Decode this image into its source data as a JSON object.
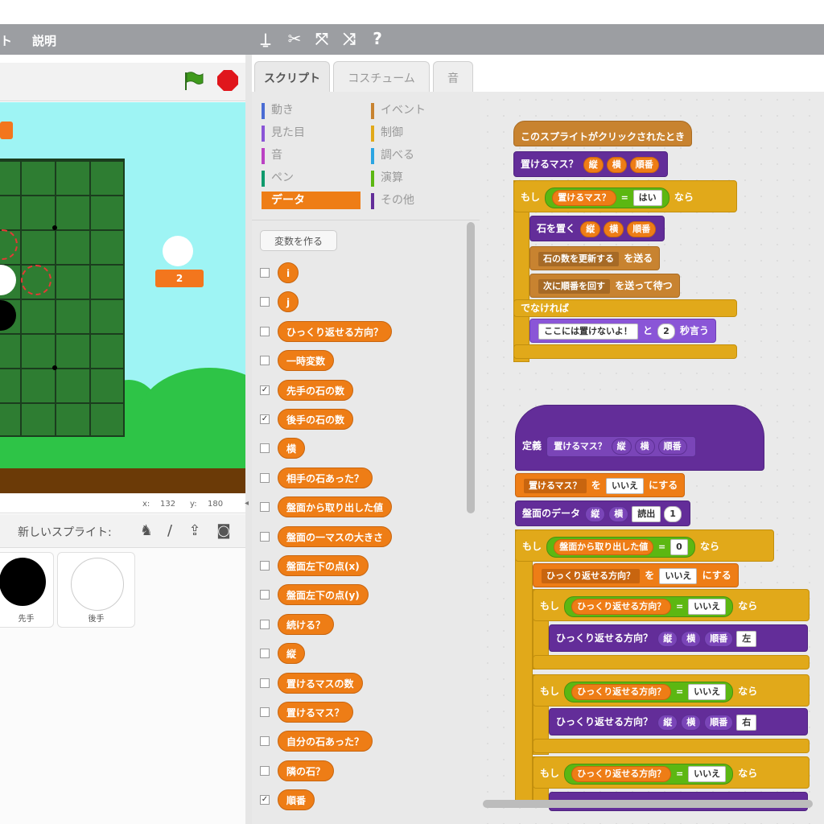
{
  "menu": {
    "item1": "ト",
    "item2": "説明"
  },
  "toolbar_icons": [
    "stamp-icon",
    "cut-icon",
    "grow-icon",
    "shrink-icon",
    "help-icon"
  ],
  "stage": {
    "score_label": "2",
    "coords": {
      "x_label": "x:",
      "x_value": "132",
      "y_label": "y:",
      "y_value": "180"
    }
  },
  "sprites": {
    "new_sprite_label": "新しいスプライト:",
    "items": [
      {
        "name": "先手"
      },
      {
        "name": "後手"
      }
    ]
  },
  "tabs": {
    "script": "スクリプト",
    "costume": "コスチューム",
    "sound": "音"
  },
  "categories": {
    "motion": "動き",
    "looks": "見た目",
    "sound": "音",
    "pen": "ペン",
    "data": "データ",
    "events": "イベント",
    "control": "制御",
    "sensing": "調べる",
    "operators": "演算",
    "more": "その他"
  },
  "palette": {
    "make_variable": "変数を作る",
    "variables": [
      {
        "name": "i",
        "checked": false
      },
      {
        "name": "j",
        "checked": false
      },
      {
        "name": "ひっくり返せる方向？",
        "checked": false
      },
      {
        "name": "一時変数",
        "checked": false
      },
      {
        "name": "先手の石の数",
        "checked": true
      },
      {
        "name": "後手の石の数",
        "checked": true
      },
      {
        "name": "横",
        "checked": false
      },
      {
        "name": "相手の石あった？",
        "checked": false
      },
      {
        "name": "盤面から取り出した値",
        "checked": false
      },
      {
        "name": "盤面の一マスの大きさ",
        "checked": false
      },
      {
        "name": "盤面左下の点(x)",
        "checked": false
      },
      {
        "name": "盤面左下の点(y)",
        "checked": false
      },
      {
        "name": "続ける？",
        "checked": false
      },
      {
        "name": "縦",
        "checked": false
      },
      {
        "name": "置けるマスの数",
        "checked": false
      },
      {
        "name": "置けるマス？",
        "checked": false
      },
      {
        "name": "自分の石あった？",
        "checked": false
      },
      {
        "name": "隣の石？",
        "checked": false
      },
      {
        "name": "順番",
        "checked": true
      }
    ]
  },
  "script1": {
    "hat": "このスプライトがクリックされたとき",
    "call1": "置けるマス？",
    "arg_tate": "縦",
    "arg_yoko": "横",
    "arg_junban": "順番",
    "if_label": "もし",
    "then_label": "なら",
    "cond_var": "置けるマス？",
    "eq": "=",
    "cond_val": "はい",
    "place": "石を置く",
    "bcast1": "石の数を更新する",
    "bcast1_tail": "を送る",
    "bcast2": "次に順番を回す",
    "bcast2_tail": "を送って待つ",
    "else_label": "でなければ",
    "say_text": "ここには置けないよ！",
    "say_mid": "と",
    "say_secs": "2",
    "say_tail": "秒言う"
  },
  "script2": {
    "define_label": "定義",
    "define_name": "置けるマス？",
    "p1": "縦",
    "p2": "横",
    "p3": "順番",
    "set_var": "置けるマス？",
    "set_to": "を",
    "set_val": "いいえ",
    "set_tail": "にする",
    "board_call": "盤面のデータ",
    "board_arg3": "読出",
    "board_arg4": "1",
    "if_label": "もし",
    "then_label": "なら",
    "cond_var": "盤面から取り出した値",
    "eq": "=",
    "cond_val": "0",
    "set2_var": "ひっくり返せる方向？",
    "set2_val": "いいえ",
    "dir_var": "ひっくり返せる方向？",
    "dir_val": "いいえ",
    "check_call": "ひっくり返せる方向？",
    "dir_args": [
      "左",
      "右"
    ]
  }
}
